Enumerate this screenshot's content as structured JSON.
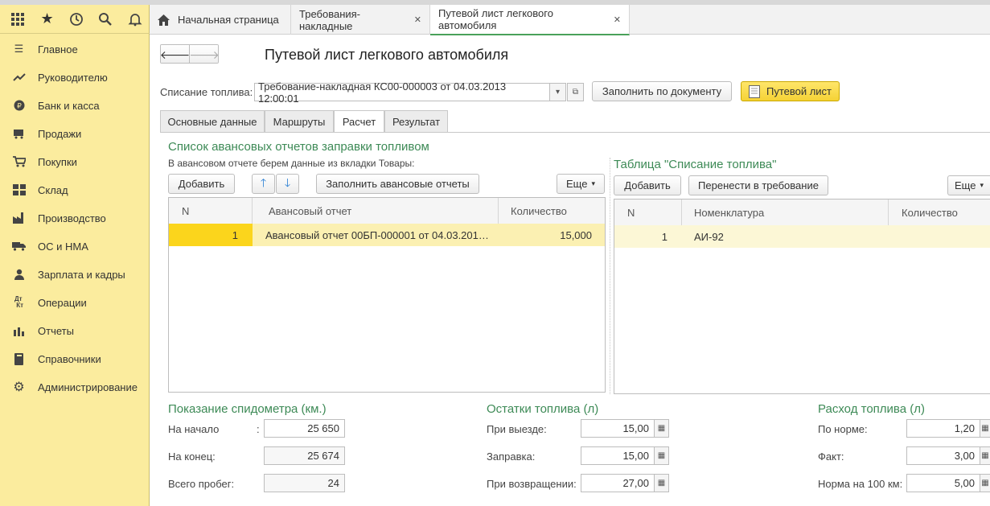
{
  "toolbar_icons": [
    "apps-grid-icon",
    "star-icon",
    "history-icon",
    "search-icon",
    "bell-icon"
  ],
  "sidebar": {
    "items": [
      {
        "label": "Главное",
        "icon": "menu-icon"
      },
      {
        "label": "Руководителю",
        "icon": "trend-icon"
      },
      {
        "label": "Банк и касса",
        "icon": "coin-icon"
      },
      {
        "label": "Продажи",
        "icon": "cart-sale-icon"
      },
      {
        "label": "Покупки",
        "icon": "cart-icon"
      },
      {
        "label": "Склад",
        "icon": "warehouse-icon"
      },
      {
        "label": "Производство",
        "icon": "factory-icon"
      },
      {
        "label": "ОС и НМА",
        "icon": "truck-icon"
      },
      {
        "label": "Зарплата и кадры",
        "icon": "person-icon"
      },
      {
        "label": "Операции",
        "icon": "dt-kt-icon"
      },
      {
        "label": "Отчеты",
        "icon": "bar-chart-icon"
      },
      {
        "label": "Справочники",
        "icon": "book-icon"
      },
      {
        "label": "Администрирование",
        "icon": "gear-icon"
      }
    ]
  },
  "tabs": [
    {
      "label": "Начальная страница"
    },
    {
      "label": "Требования-накладные"
    },
    {
      "label": "Путевой лист легкового автомобиля"
    }
  ],
  "form": {
    "title": "Путевой лист легкового автомобиля",
    "fuel_writeoff_label": "Списание топлива:",
    "fuel_writeoff_value": "Требование-накладная КС00-000003 от 04.03.2013 12:00:01",
    "fill_by_doc_button": "Заполнить по документу",
    "waybill_button": "Путевой лист",
    "form_tabs": [
      "Основные данные",
      "Маршруты",
      "Расчет",
      "Результат"
    ],
    "active_form_tab": "Расчет"
  },
  "advance_section": {
    "title": "Список авансовых отчетов заправки топливом",
    "hint": "В авансовом отчете берем данные из вкладки Товары:",
    "add_button": "Добавить",
    "fill_button": "Заполнить авансовые отчеты",
    "more_button": "Еще",
    "columns": [
      "N",
      "Авансовый отчет",
      "Количество"
    ],
    "rows": [
      {
        "n": "1",
        "report": "Авансовый отчет 00БП-000001 от 04.03.201…",
        "qty": "15,000"
      }
    ]
  },
  "writeoff_section": {
    "title": "Таблица \"Списание топлива\"",
    "add_button": "Добавить",
    "transfer_button": "Перенести в требование",
    "more_button": "Еще",
    "columns": [
      "N",
      "Номенклатура",
      "Количество"
    ],
    "rows": [
      {
        "n": "1",
        "item": "АИ-92",
        "qty": ""
      }
    ]
  },
  "speedometer": {
    "title": "Показание спидометра (км.)",
    "start_label": "На начало",
    "start_colon": ":",
    "start_value": "25 650",
    "end_label": "На конец:",
    "end_value": "25 674",
    "total_label": "Всего пробег:",
    "total_value": "24"
  },
  "fuel_balance": {
    "title": "Остатки топлива (л)",
    "departure_label": "При выезде:",
    "departure_value": "15,00",
    "refuel_label": "Заправка:",
    "refuel_value": "15,00",
    "return_label": "При возвращении:",
    "return_value": "27,00"
  },
  "fuel_consumption": {
    "title": "Расход топлива (л)",
    "norm_label": "По норме:",
    "norm_value": "1,20",
    "fact_label": "Факт:",
    "fact_value": "3,00",
    "per100_label": "Норма на 100 км:",
    "per100_value": "5,00"
  },
  "colors": {
    "sidebar_bg": "#fbec9e",
    "accent_green": "#3d8a56",
    "selection_yellow": "#fbe74b",
    "button_yellow": "#f5d235"
  }
}
